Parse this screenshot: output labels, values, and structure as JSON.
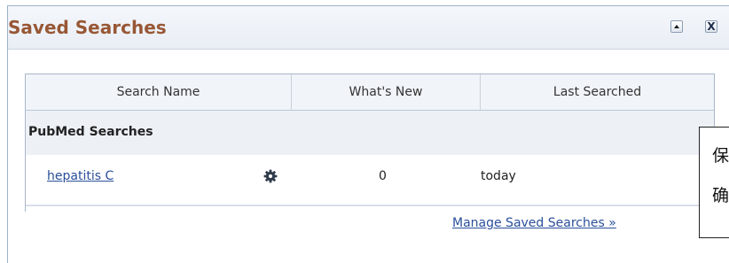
{
  "panel": {
    "title": "Saved Searches",
    "collapse_button": "collapse",
    "close_button_label": "X"
  },
  "table": {
    "headers": [
      "Search Name",
      "What's New",
      "Last Searched"
    ],
    "group_label": "PubMed Searches",
    "rows": [
      {
        "name": "hepatitis C",
        "action_icon": "gear-icon",
        "whats_new": "0",
        "last_searched": "today"
      }
    ]
  },
  "footer": {
    "manage_link": "Manage Saved Searches »"
  },
  "tooltip": {
    "line1": "保",
    "line2": "确"
  },
  "colors": {
    "title": "#985735",
    "link": "#2a4f9a",
    "header_bg": "#eef2f7",
    "group_bg": "#edf1f6",
    "border": "#a9b7c9"
  }
}
